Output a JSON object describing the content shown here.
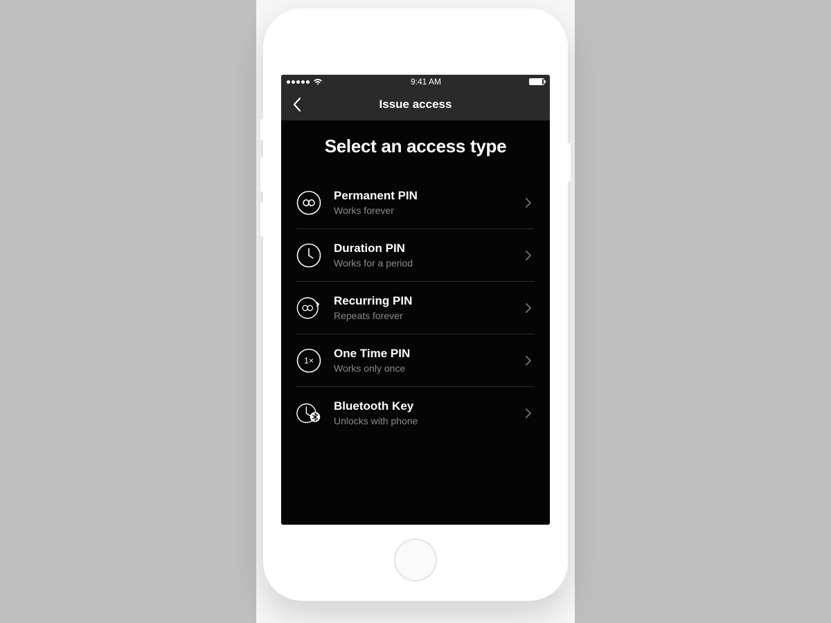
{
  "statusbar": {
    "time": "9:41 AM"
  },
  "navbar": {
    "title": "Issue access"
  },
  "page": {
    "title": "Select an access type"
  },
  "options": [
    {
      "title": "Permanent PIN",
      "subtitle": "Works forever",
      "icon": "infinity-icon"
    },
    {
      "title": "Duration PIN",
      "subtitle": "Works for a period",
      "icon": "clock-icon"
    },
    {
      "title": "Recurring PIN",
      "subtitle": "Repeats forever",
      "icon": "recurring-icon"
    },
    {
      "title": "One Time PIN",
      "subtitle": "Works only once",
      "icon": "one-time-icon"
    },
    {
      "title": "Bluetooth Key",
      "subtitle": "Unlocks with phone",
      "icon": "bluetooth-key-icon"
    }
  ]
}
